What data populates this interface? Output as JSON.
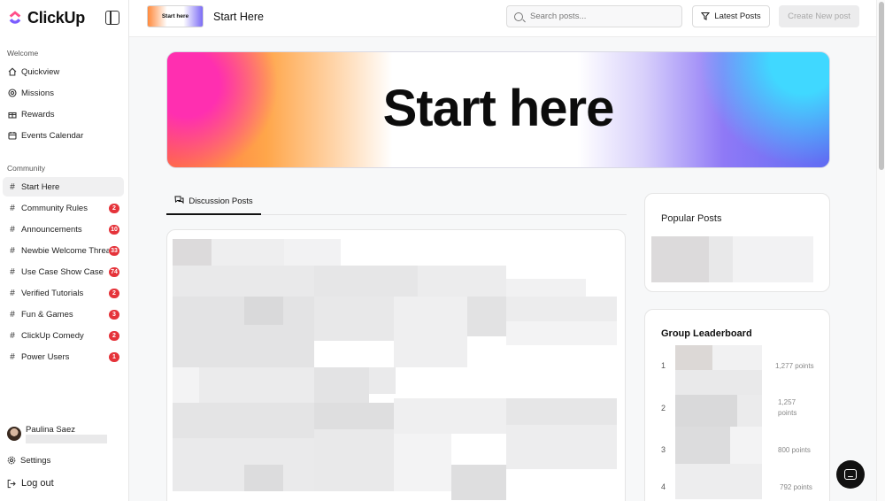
{
  "app": {
    "name": "ClickUp"
  },
  "sidebar": {
    "welcome_label": "Welcome",
    "welcome_items": [
      {
        "label": "Quickview",
        "icon": "home-icon"
      },
      {
        "label": "Missions",
        "icon": "target-icon"
      },
      {
        "label": "Rewards",
        "icon": "gift-icon"
      },
      {
        "label": "Events Calendar",
        "icon": "calendar-icon"
      }
    ],
    "community_label": "Community",
    "community_items": [
      {
        "label": "Start Here",
        "badge": "",
        "active": true
      },
      {
        "label": "Community Rules",
        "badge": "2"
      },
      {
        "label": "Announcements",
        "badge": "10"
      },
      {
        "label": "Newbie Welcome Thread",
        "badge": "33"
      },
      {
        "label": "Use Case Show Case",
        "badge": "74"
      },
      {
        "label": "Verified Tutorials",
        "badge": "2"
      },
      {
        "label": "Fun & Games",
        "badge": "3"
      },
      {
        "label": "ClickUp Comedy",
        "badge": "2"
      },
      {
        "label": "Power Users",
        "badge": "1"
      }
    ],
    "user": {
      "name": "Paulina Saez"
    },
    "settings_label": "Settings",
    "logout_label": "Log out"
  },
  "header": {
    "thumb_text": "Start here",
    "title": "Start Here",
    "search_placeholder": "Search posts...",
    "latest_label": "Latest Posts",
    "create_label": "Create New post"
  },
  "hero": {
    "text": "Start here"
  },
  "tabs": [
    {
      "label": "Discussion Posts"
    }
  ],
  "popular": {
    "title": "Popular Posts"
  },
  "leaderboard": {
    "title": "Group Leaderboard",
    "entries": [
      {
        "rank": "1",
        "points": "1,277 points"
      },
      {
        "rank": "2",
        "points_line1": "1,257",
        "points_line2": "points"
      },
      {
        "rank": "3",
        "points": "800 points"
      },
      {
        "rank": "4",
        "points": "792 points"
      }
    ]
  },
  "colors": {
    "badge": "#e5333a",
    "accent_orange": "#ff8a3d",
    "accent_purple": "#5f6cf3"
  }
}
